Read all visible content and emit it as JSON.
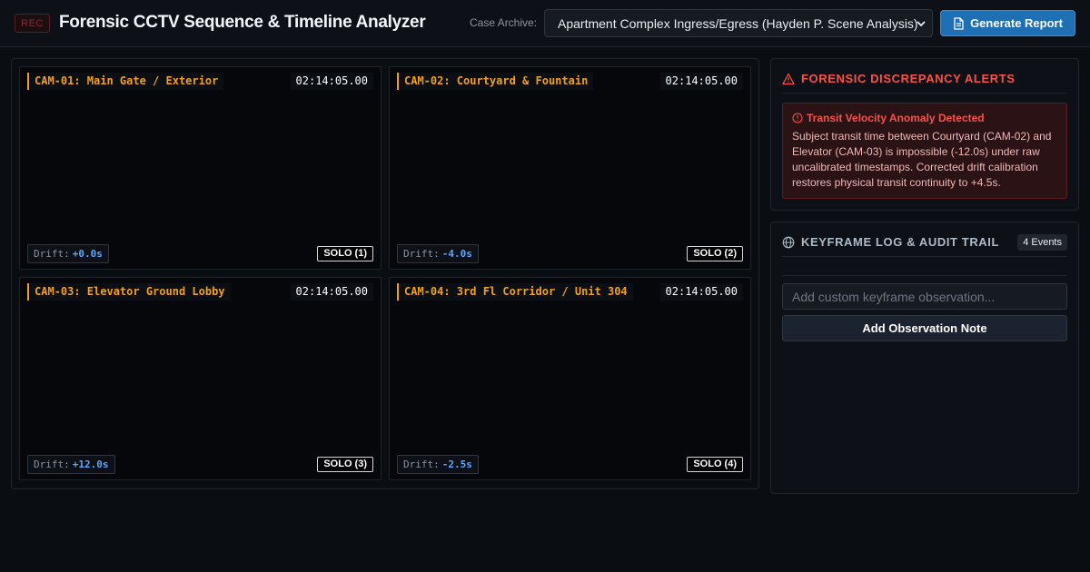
{
  "header": {
    "rec_badge": "REC",
    "title": "Forensic CCTV Sequence & Timeline Analyzer",
    "archive_label": "Case Archive:",
    "archive_selected": "Apartment Complex Ingress/Egress (Hayden P. Scene Analysis)",
    "report_button": "Generate Report"
  },
  "cameras": [
    {
      "title": "CAM-01: Main Gate / Exterior",
      "time": "02:14:05.00",
      "drift_label": "Drift:",
      "drift_value": "+0.0s",
      "solo": "SOLO (1)"
    },
    {
      "title": "CAM-02: Courtyard & Fountain",
      "time": "02:14:05.00",
      "drift_label": "Drift:",
      "drift_value": "-4.0s",
      "solo": "SOLO (2)"
    },
    {
      "title": "CAM-03: Elevator Ground Lobby",
      "time": "02:14:05.00",
      "drift_label": "Drift:",
      "drift_value": "+12.0s",
      "solo": "SOLO (3)"
    },
    {
      "title": "CAM-04: 3rd Fl Corridor / Unit 304",
      "time": "02:14:05.00",
      "drift_label": "Drift:",
      "drift_value": "-2.5s",
      "solo": "SOLO (4)"
    }
  ],
  "alerts": {
    "title": "FORENSIC DISCREPANCY ALERTS",
    "items": [
      {
        "heading": "Transit Velocity Anomaly Detected",
        "body": "Subject transit time between Courtyard (CAM-02) and Elevator (CAM-03) is impossible (-12.0s) under raw uncalibrated timestamps. Corrected drift calibration restores physical transit continuity to +4.5s."
      }
    ]
  },
  "keyframe_log": {
    "title": "KEYFRAME LOG & AUDIT TRAIL",
    "events_badge": "4 Events",
    "input_placeholder": "Add custom keyframe observation...",
    "add_button": "Add Observation Note"
  },
  "colors": {
    "accent_amber": "#f0a020",
    "alert_red": "#f85149",
    "primary_blue": "#1f6fb5",
    "drift_blue": "#58a6ff"
  },
  "icons": {
    "report": "document-icon",
    "alerts": "warning-triangle-icon",
    "alert_item": "alert-circle-icon",
    "log": "globe-icon",
    "select": "chevron-down-icon"
  }
}
